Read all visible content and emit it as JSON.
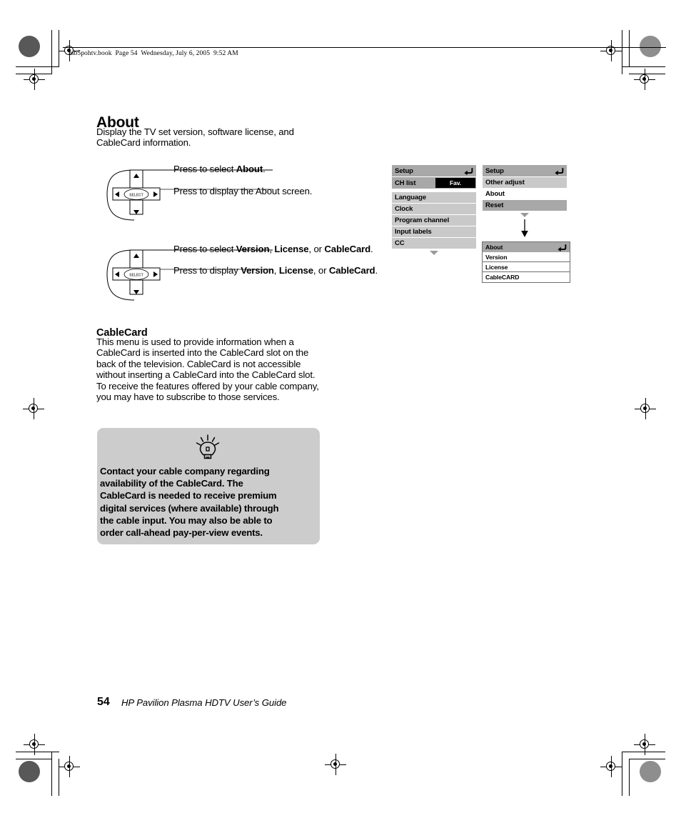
{
  "page": {
    "header_note": "mb5pohtv.book  Page 54  Wednesday, July 6, 2005  9:52 AM",
    "footer_page_number": "54",
    "footer_title": "HP Pavilion Plasma HDTV User’s Guide"
  },
  "section": {
    "heading": "About",
    "intro_line1": "Display the TV set version, software license, and",
    "intro_line2": "CableCard information."
  },
  "steps": [
    {
      "id": "step-select-about",
      "prefix": "Press to select ",
      "bold1": "About",
      "suffix": "."
    },
    {
      "id": "step-display-about",
      "prefix": "Press to display the About screen.",
      "bold1": "",
      "suffix": ""
    },
    {
      "id": "step-select-version",
      "prefix": "Press to select ",
      "bold1": "Version",
      "mid1": ", ",
      "bold2": "License",
      "mid2": ", or ",
      "bold3": "CableCard",
      "suffix": "."
    },
    {
      "id": "step-display-version",
      "prefix": "Press to display ",
      "bold1": "Version",
      "mid1": ", ",
      "bold2": "License",
      "mid2": ", or ",
      "bold3": "CableCard",
      "suffix": "."
    }
  ],
  "remote": {
    "select_label": "SELECT",
    "up_icon": "triangle-up-icon",
    "down_icon": "triangle-down-icon",
    "left_icon": "triangle-left-icon",
    "right_icon": "triangle-right-icon"
  },
  "osd_setup_main": {
    "title": "Setup",
    "back_icon": "back-arrow-icon",
    "scroll_icon": "triangle-down-icon",
    "rows": [
      {
        "label": "CH list",
        "badge": "Fav.",
        "style": "dark"
      },
      {
        "label": "Language",
        "badge": "",
        "style": "grey"
      },
      {
        "label": "Clock",
        "badge": "",
        "style": "grey"
      },
      {
        "label": "Program channel",
        "badge": "",
        "style": "grey"
      },
      {
        "label": "Input labels",
        "badge": "",
        "style": "grey"
      },
      {
        "label": "CC",
        "badge": "",
        "style": "grey"
      }
    ]
  },
  "osd_setup_scrolled": {
    "title": "Setup",
    "back_icon": "back-arrow-icon",
    "scroll_icon": "triangle-down-icon",
    "rows": [
      {
        "label": "Other adjust",
        "style": "grey"
      },
      {
        "label": "About",
        "style": "white"
      },
      {
        "label": "Reset",
        "style": "grey"
      }
    ]
  },
  "osd_about": {
    "title": "About",
    "back_icon": "back-arrow-icon",
    "rows": [
      {
        "label": "Version"
      },
      {
        "label": "License"
      },
      {
        "label": "CableCARD"
      }
    ]
  },
  "flow": {
    "arrow_icon": "arrow-down-icon"
  },
  "cablecard": {
    "heading": "CableCard",
    "body_lines": [
      "This menu is used to provide information when a",
      "CableCard is inserted into the CableCard slot on the",
      "back of the television. CableCard is not accessible",
      "without inserting a CableCard into the CableCard slot.",
      "To receive the features offered by your cable company,",
      "you may have to subscribe to those services."
    ]
  },
  "tip": {
    "icon": "lightbulb-icon",
    "lines": [
      "Contact your cable company regarding",
      "availability of the CableCard. The",
      "CableCard is needed to receive premium",
      "digital services (where available) through",
      "the cable input. You may also be able to",
      "order call-ahead pay-per-view events."
    ]
  },
  "colors": {
    "osd_title_bar": "#a8a8a8",
    "osd_item": "#c9c9c9",
    "osd_selected": "#ffffff",
    "tip_background": "#cccccc",
    "badge_background": "#000000"
  }
}
